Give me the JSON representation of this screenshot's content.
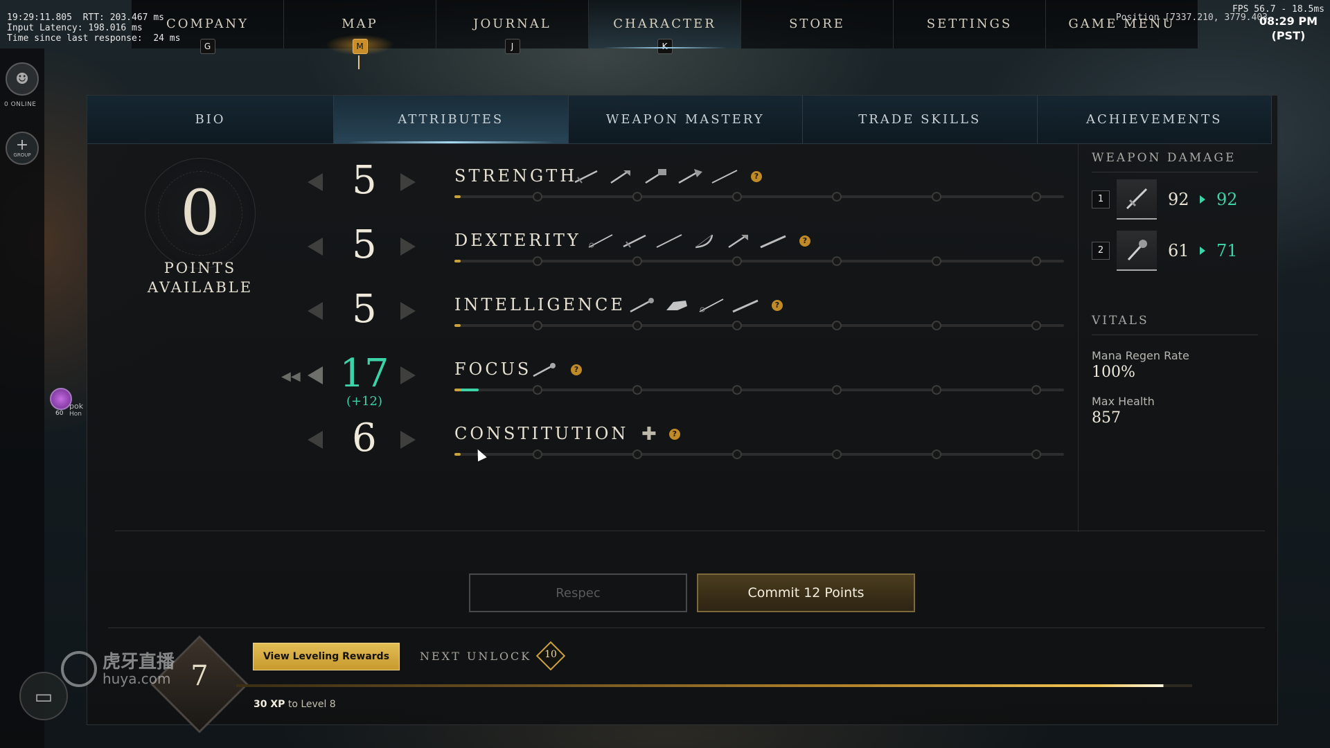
{
  "debug": {
    "line1": "19:29:11.805  RTT: 203.467 ms",
    "line2": "Input Latency: 198.016 ms",
    "line3": "Time since last response:  24 ms"
  },
  "fps": {
    "line1": "FPS 56.7 - 18.5ms",
    "line2": "08:29 PM"
  },
  "position_text": "Position [7337.210, 3779.403",
  "clock": {
    "time": "08:29 PM",
    "zone": "(PST)"
  },
  "topnav": [
    {
      "label": "COMPANY",
      "key": "G"
    },
    {
      "label": "MAP",
      "key": "M"
    },
    {
      "label": "JOURNAL",
      "key": "J"
    },
    {
      "label": "CHARACTER",
      "key": "K"
    },
    {
      "label": "STORE",
      "key": ""
    },
    {
      "label": "SETTINGS",
      "key": ""
    },
    {
      "label": "GAME MENU",
      "key": ""
    }
  ],
  "rail": {
    "online": "0 ONLINE",
    "group_label": "GROUP",
    "member_name": "pok",
    "member_sub": "Hon",
    "member_level": "60"
  },
  "subtabs": [
    "BIO",
    "ATTRIBUTES",
    "WEAPON MASTERY",
    "TRADE SKILLS",
    "ACHIEVEMENTS"
  ],
  "points": {
    "value": "0",
    "label_line1": "POINTS",
    "label_line2": "AVAILABLE"
  },
  "attributes": [
    {
      "name": "STRENGTH",
      "value": "5",
      "bonus": "",
      "weapons": [
        "sword-icon",
        "hatchet-icon",
        "war-hammer-icon",
        "great-axe-icon",
        "spear-icon"
      ],
      "progress": 0.01
    },
    {
      "name": "DEXTERITY",
      "value": "5",
      "bonus": "",
      "weapons": [
        "rapier-icon",
        "sword-icon",
        "spear-icon",
        "bow-icon",
        "hatchet-icon",
        "musket-icon"
      ],
      "progress": 0.01
    },
    {
      "name": "INTELLIGENCE",
      "value": "5",
      "bonus": "",
      "weapons": [
        "fire-staff-icon",
        "gauntlet-icon",
        "rapier-icon",
        "musket-icon"
      ],
      "progress": 0.01
    },
    {
      "name": "FOCUS",
      "value": "17",
      "bonus": "(+12)",
      "weapons": [
        "life-staff-icon"
      ],
      "progress": 0.04
    },
    {
      "name": "CONSTITUTION",
      "value": "6",
      "bonus": "",
      "weapons": [],
      "progress": 0.01
    }
  ],
  "stats": {
    "weapon_damage_title": "WEAPON DAMAGE",
    "weapons": [
      {
        "slot": "1",
        "old": "92",
        "new": "92"
      },
      {
        "slot": "2",
        "old": "61",
        "new": "71"
      }
    ],
    "vitals_title": "VITALS",
    "vitals": [
      {
        "label": "Mana Regen Rate",
        "value": "100%"
      },
      {
        "label": "Max Health",
        "value": "857"
      }
    ]
  },
  "buttons": {
    "respec": "Respec",
    "commit": "Commit  12  Points"
  },
  "leveling": {
    "level": "7",
    "rewards_button": "View Leveling Rewards",
    "next_unlock_label": "NEXT UNLOCK",
    "next_unlock_level": "10",
    "xp_amount": "30 XP",
    "xp_suffix": " to Level 8",
    "xp_progress": 0.91
  },
  "watermark": {
    "cn": "虎牙直播",
    "en": "huya.com"
  }
}
